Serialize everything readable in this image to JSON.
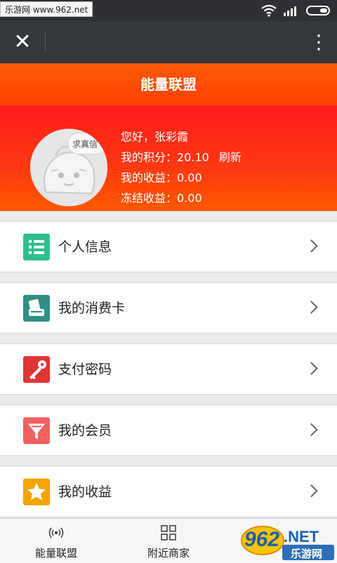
{
  "status_bar": {
    "watermark": "乐游网 www.962.net"
  },
  "navbar": {
    "close_label": "✕",
    "more_label": "⋮"
  },
  "page_title": "能量联盟",
  "profile": {
    "greeting": "您好，张彩霞",
    "points_line": "我的积分：20.10",
    "refresh_label": "刷新",
    "earnings_line": "我的收益：0.00",
    "frozen_line": "冻结收益：0.00",
    "avatar_text": "求真信"
  },
  "menu": {
    "items": [
      {
        "label": "个人信息",
        "icon": "list-icon",
        "color": "#2dbf8c"
      },
      {
        "label": "我的消费卡",
        "icon": "card-icon",
        "color": "#2f8f82"
      },
      {
        "label": "支付密码",
        "icon": "key-icon",
        "color": "#e03535"
      },
      {
        "label": "我的会员",
        "icon": "funnel-icon",
        "color": "#f06262"
      },
      {
        "label": "我的收益",
        "icon": "star-icon",
        "color": "#f5a400"
      }
    ]
  },
  "tabs": [
    {
      "label": "能量联盟",
      "icon": "signal-icon"
    },
    {
      "label": "附近商家",
      "icon": "grid-icon"
    }
  ],
  "logo": {
    "number": "962",
    "suffix": ".NET",
    "sub": "乐游网"
  },
  "colors": {
    "accent": "#ff4a00",
    "profile_bg": "#ff2a14",
    "navbar": "#34373b"
  }
}
